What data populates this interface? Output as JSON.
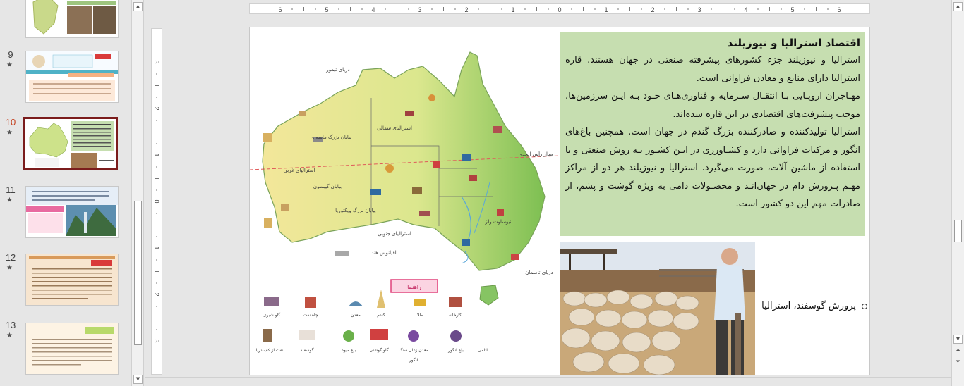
{
  "thumbnails": [
    {
      "num": "",
      "star": false,
      "selected": false,
      "style": "map"
    },
    {
      "num": "9",
      "star": true,
      "selected": false,
      "style": "doc"
    },
    {
      "num": "10",
      "star": true,
      "selected": true,
      "style": "slide"
    },
    {
      "num": "11",
      "star": true,
      "selected": false,
      "style": "landscape"
    },
    {
      "num": "12",
      "star": true,
      "selected": false,
      "style": "notebook"
    },
    {
      "num": "13",
      "star": true,
      "selected": false,
      "style": "cream"
    }
  ],
  "star_glyph": "★",
  "ruler": {
    "horizontal_labels": [
      "6",
      "5",
      "4",
      "3",
      "2",
      "1",
      "0",
      "1",
      "2",
      "3",
      "4",
      "5",
      "6"
    ],
    "vertical_labels": [
      "3",
      "2",
      "1",
      "0",
      "1",
      "2",
      "3"
    ]
  },
  "slide": {
    "title": "اقتصاد استرالیا و نیوزیلند",
    "paragraphs": [
      "استرالیا و نیوزیلند جزء کشورهای پیشرفته صنعتی در جهان هستند. قاره استرالیا دارای منابع و معادن فراوانی است.",
      "مهـاجران اروپـایی بـا انتقـال سـرمایه و فناوری‌هـای خـود بـه ایـن سرزمین‌ها، موجب پیشرفت‌های اقتصادی در این قاره شده‌اند.",
      "استرالیا تولیدکننده و صادرکننده بزرگ گندم در جهان است. همچنین باغ‌های انگور و مرکبات فراوانی دارد و کشـاورزی در ایـن کشـور بـه روش صنعتی و با استفاده از ماشین آلات، صورت می‌گیرد. استرالیا و نیوزیلند هر دو از مراکز مهـم پـرورش دام در جهان‌انـد و محصـولات دامی به ویژه گوشت و پشم، از صادرات مهم این دو کشور است."
    ],
    "caption": "پرورش گوسفند، استرالیا",
    "box_color": "#c6deb0",
    "map": {
      "labels": {
        "timor": "دریای تیمور",
        "north_aus": "استرالیای شمالی",
        "great_sandy": "بیابان بزرگ ماسه‌ای",
        "gibson": "بیابان گیبسون",
        "victoria": "بیابان بزرگ ویکتوریا",
        "south_aus": "استرالیای جنوبی",
        "west_aus": "استرالیای غربی",
        "new_south_wales": "نیوساوت ولز",
        "tropic": "مدار رأس الجدی",
        "ocean": "اقیانوس هند",
        "tasman": "دریای تاسمان"
      },
      "legend_title": "راهنما",
      "legend_items": [
        "کارخانه",
        "طلا",
        "گندم",
        "معدن",
        "چاه نفت",
        "گاو شیری",
        "انگور",
        "باغ انگور",
        "معدن زغال سنگ",
        "گاو گوشتی",
        "باغ میوه",
        "گوسفند",
        "نفت از کف دریا",
        "اتلمی"
      ]
    }
  }
}
